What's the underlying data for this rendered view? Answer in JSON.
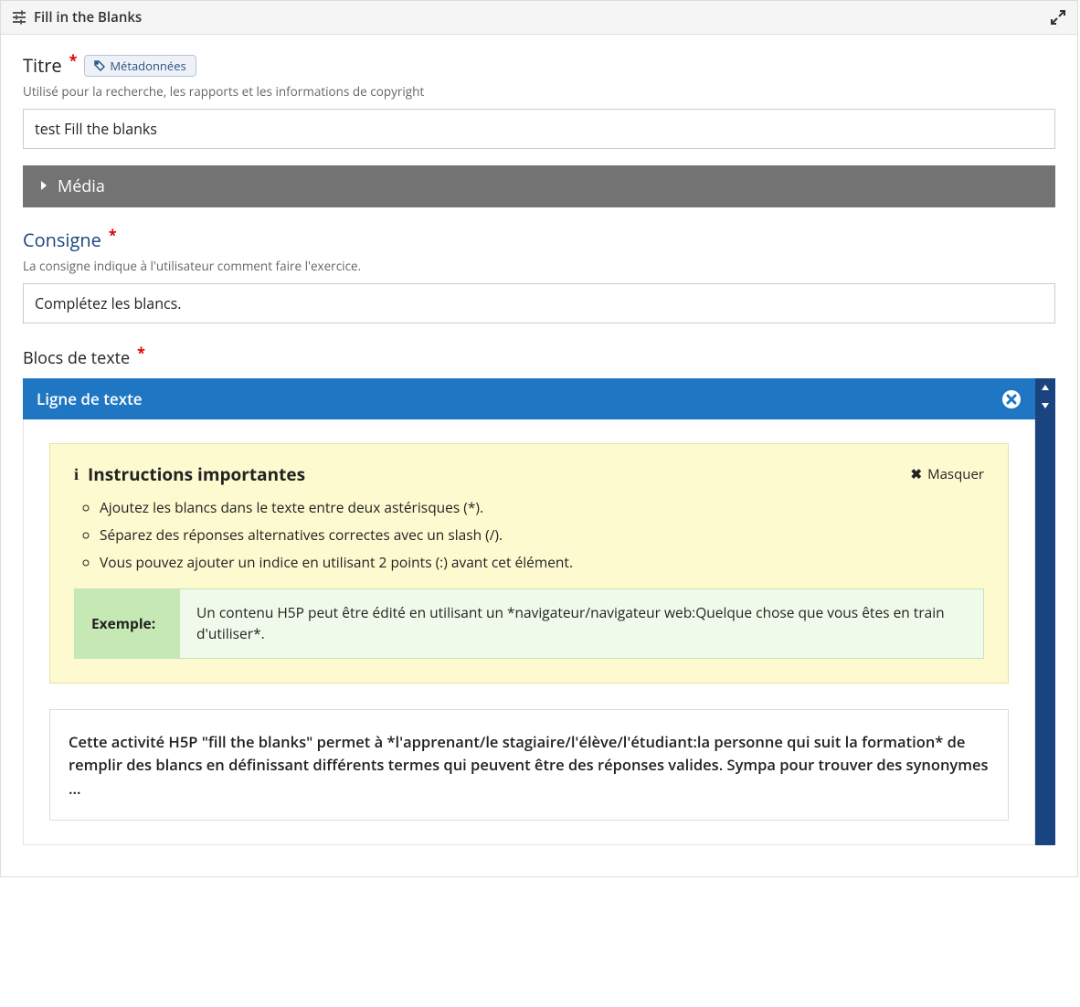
{
  "header": {
    "title": "Fill in the Blanks"
  },
  "title_field": {
    "label": "Titre",
    "chip": "Métadonnées",
    "desc": "Utilisé pour la recherche, les rapports et les informations de copyright",
    "value": "test Fill the blanks"
  },
  "media_bar": {
    "label": "Média"
  },
  "consigne": {
    "label": "Consigne",
    "desc": "La consigne indique à l'utilisateur comment faire l'exercice.",
    "value": "Complétez les blancs."
  },
  "blocks": {
    "label": "Blocs de texte",
    "line_header": "Ligne de texte",
    "instructions_title": "Instructions importantes",
    "hide_label": "Masquer",
    "items": [
      "Ajoutez les blancs dans le texte entre deux astérisques (*).",
      "Séparez des réponses alternatives correctes avec un slash (/).",
      "Vous pouvez ajouter un indice en utilisant 2 points (:) avant cet élément."
    ],
    "example_label": "Exemple:",
    "example_body": "Un contenu H5P peut être édité en utilisant un *navigateur/navigateur web:Quelque chose que vous êtes en train d'utiliser*.",
    "editor_text": "Cette activité H5P \"fill the blanks\" permet à *l'apprenant/le stagiaire/l'élève/l'étudiant:la personne qui suit la formation* de remplir des blancs en définissant différents termes qui peuvent être des réponses valides. Sympa pour trouver des synonymes ..."
  }
}
